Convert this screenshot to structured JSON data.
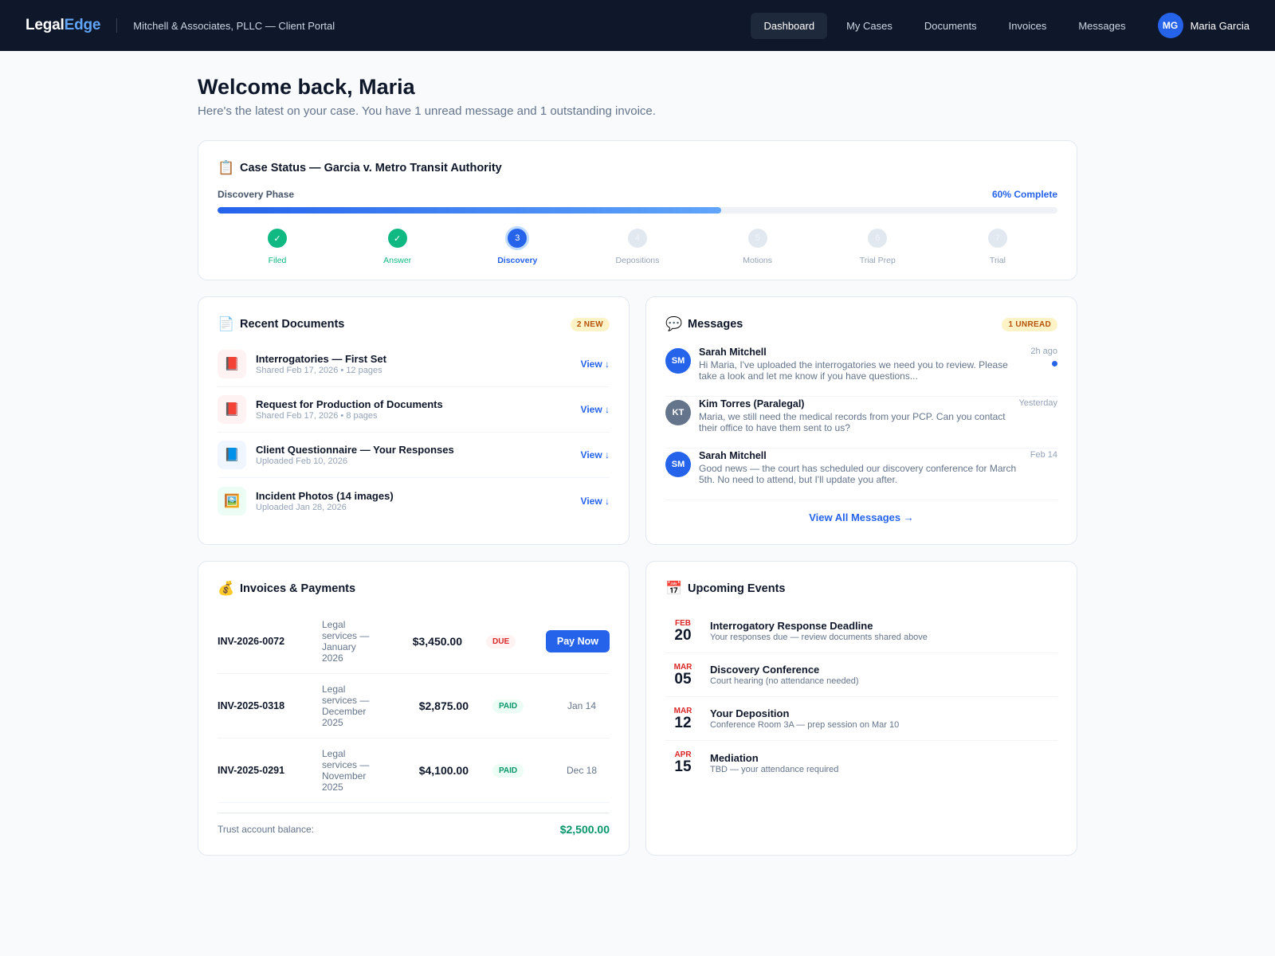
{
  "header": {
    "logo_a": "Legal",
    "logo_b": "Edge",
    "firm": "Mitchell & Associates, PLLC — Client Portal",
    "nav": [
      "Dashboard",
      "My Cases",
      "Documents",
      "Invoices",
      "Messages"
    ],
    "active_nav": "Dashboard",
    "user_initials": "MG",
    "user_name": "Maria Garcia"
  },
  "welcome": {
    "title": "Welcome back, Maria",
    "subtitle": "Here's the latest on your case. You have 1 unread message and 1 outstanding invoice."
  },
  "case": {
    "title": "Case Status — Garcia v. Metro Transit Authority",
    "phase": "Discovery Phase",
    "percent_label": "60% Complete",
    "progress": 0.6,
    "steps": [
      {
        "marker": "✓",
        "label": "Filed",
        "state": "done"
      },
      {
        "marker": "✓",
        "label": "Answer",
        "state": "done"
      },
      {
        "marker": "3",
        "label": "Discovery",
        "state": "current"
      },
      {
        "marker": "4",
        "label": "Depositions",
        "state": "pending"
      },
      {
        "marker": "5",
        "label": "Motions",
        "state": "pending"
      },
      {
        "marker": "6",
        "label": "Trial Prep",
        "state": "pending"
      },
      {
        "marker": "7",
        "label": "Trial",
        "state": "pending"
      }
    ]
  },
  "documents": {
    "title": "Recent Documents",
    "badge": "2 NEW",
    "items": [
      {
        "name": "Interrogatories — First Set",
        "meta": "Shared Feb 17, 2026 • 12 pages",
        "icon": "pdf-icon",
        "glyph": "📕",
        "action": "View ↓"
      },
      {
        "name": "Request for Production of Documents",
        "meta": "Shared Feb 17, 2026 • 8 pages",
        "icon": "pdf-icon",
        "glyph": "📕",
        "action": "View ↓"
      },
      {
        "name": "Client Questionnaire — Your Responses",
        "meta": "Uploaded Feb 10, 2026",
        "icon": "word-icon",
        "glyph": "📘",
        "action": "View ↓"
      },
      {
        "name": "Incident Photos (14 images)",
        "meta": "Uploaded Jan 28, 2026",
        "icon": "image-icon",
        "glyph": "🖼️",
        "action": "View ↓"
      }
    ]
  },
  "messages": {
    "title": "Messages",
    "badge": "1 UNREAD",
    "items": [
      {
        "initials": "SM",
        "from": "Sarah Mitchell",
        "text": "Hi Maria, I've uploaded the interrogatories we need you to review. Please take a look and let me know if you have questions...",
        "time": "2h ago",
        "unread": true,
        "color": "blue"
      },
      {
        "initials": "KT",
        "from": "Kim Torres (Paralegal)",
        "text": "Maria, we still need the medical records from your PCP. Can you contact their office to have them sent to us?",
        "time": "Yesterday",
        "unread": false,
        "color": "gray"
      },
      {
        "initials": "SM",
        "from": "Sarah Mitchell",
        "text": "Good news — the court has scheduled our discovery conference for March 5th. No need to attend, but I'll update you after.",
        "time": "Feb 14",
        "unread": false,
        "color": "blue"
      }
    ],
    "view_all": "View All Messages →"
  },
  "invoices": {
    "title": "Invoices & Payments",
    "items": [
      {
        "number": "INV-2026-0072",
        "desc": "Legal services — January 2026",
        "amount": "$3,450.00",
        "status": "DUE",
        "action": "Pay Now",
        "date": ""
      },
      {
        "number": "INV-2025-0318",
        "desc": "Legal services — December 2025",
        "amount": "$2,875.00",
        "status": "PAID",
        "action": "",
        "date": "Jan 14"
      },
      {
        "number": "INV-2025-0291",
        "desc": "Legal services — November 2025",
        "amount": "$4,100.00",
        "status": "PAID",
        "action": "",
        "date": "Dec 18"
      }
    ],
    "trust_label": "Trust account balance:",
    "trust_value": "$2,500.00"
  },
  "events": {
    "title": "Upcoming Events",
    "items": [
      {
        "month": "FEB",
        "day": "20",
        "title": "Interrogatory Response Deadline",
        "sub": "Your responses due — review documents shared above"
      },
      {
        "month": "MAR",
        "day": "05",
        "title": "Discovery Conference",
        "sub": "Court hearing (no attendance needed)"
      },
      {
        "month": "MAR",
        "day": "12",
        "title": "Your Deposition",
        "sub": "Conference Room 3A — prep session on Mar 10"
      },
      {
        "month": "APR",
        "day": "15",
        "title": "Mediation",
        "sub": "TBD — your attendance required"
      }
    ]
  }
}
